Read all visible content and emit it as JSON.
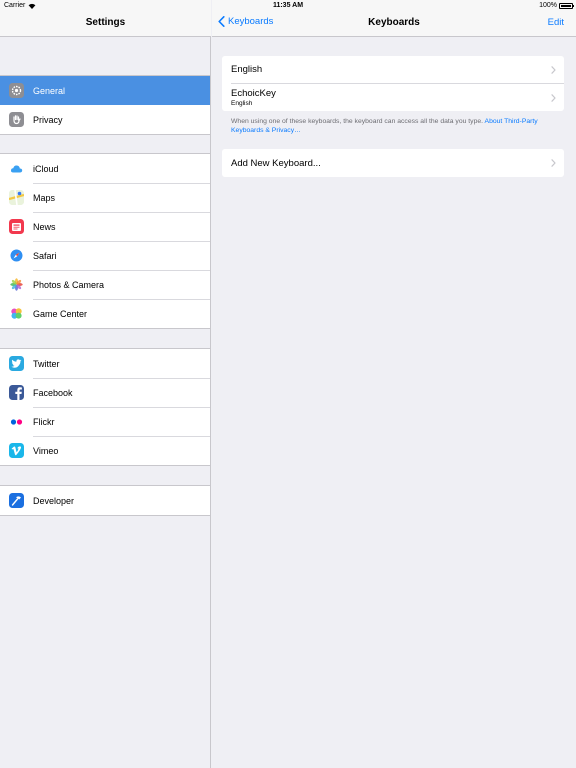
{
  "status_bar": {
    "carrier": "Carrier",
    "time": "11:35 AM",
    "battery": "100%"
  },
  "master": {
    "title": "Settings",
    "groups": [
      [
        {
          "label": "General",
          "icon": "gear-icon",
          "selected": true
        },
        {
          "label": "Privacy",
          "icon": "hand-icon",
          "selected": false
        }
      ],
      [
        {
          "label": "iCloud",
          "icon": "cloud-icon"
        },
        {
          "label": "Maps",
          "icon": "maps-icon"
        },
        {
          "label": "News",
          "icon": "news-icon"
        },
        {
          "label": "Safari",
          "icon": "compass-icon"
        },
        {
          "label": "Photos & Camera",
          "icon": "photos-icon"
        },
        {
          "label": "Game Center",
          "icon": "game-center-icon"
        }
      ],
      [
        {
          "label": "Twitter",
          "icon": "twitter-icon"
        },
        {
          "label": "Facebook",
          "icon": "facebook-icon"
        },
        {
          "label": "Flickr",
          "icon": "flickr-icon"
        },
        {
          "label": "Vimeo",
          "icon": "vimeo-icon"
        }
      ],
      [
        {
          "label": "Developer",
          "icon": "hammer-icon"
        }
      ]
    ]
  },
  "detail": {
    "back_label": "Keyboards",
    "title": "Keyboards",
    "edit_label": "Edit",
    "keyboards": [
      {
        "name": "English",
        "subtitle": ""
      },
      {
        "name": "EchoicKey",
        "subtitle": "English"
      }
    ],
    "footnote_text": "When using one of these keyboards, the keyboard can access all the data you type. ",
    "footnote_link": "About Third-Party Keyboards & Privacy…",
    "add_label": "Add New Keyboard..."
  },
  "colors": {
    "accent": "#0a7bff",
    "selected_row": "#4a90e2",
    "background": "#efeff4"
  }
}
